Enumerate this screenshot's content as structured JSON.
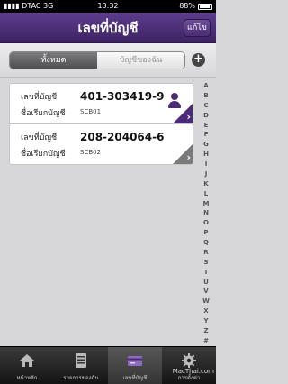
{
  "status_bar": {
    "carrier": "DTAC",
    "network": "3G",
    "time": "13:32",
    "battery": "88%"
  },
  "nav": {
    "title": "เลขที่บัญชี",
    "edit_label": "แก้ไข"
  },
  "segment": {
    "options": [
      "ทั้งหมด",
      "บัญชีของฉัน"
    ],
    "selected": "ทั้งหมด"
  },
  "add_icon": "+",
  "accounts": [
    {
      "label_number": "เลขที่บัญชี",
      "label_name": "ชื่อเรียกบัญชี",
      "number": "401-303419-9",
      "code": "SCB01",
      "owner_icon": "person-icon",
      "accent": "#4b2a78"
    },
    {
      "label_number": "เลขที่บัญชี",
      "label_name": "ชื่อเรียกบัญชี",
      "number": "208-204064-6",
      "code": "SCB02",
      "accent": "#7a7a7a"
    }
  ],
  "index_letters": [
    "A",
    "B",
    "C",
    "D",
    "E",
    "F",
    "G",
    "H",
    "I",
    "J",
    "K",
    "L",
    "M",
    "N",
    "O",
    "P",
    "Q",
    "R",
    "S",
    "T",
    "U",
    "V",
    "W",
    "X",
    "Y",
    "Z",
    "#"
  ],
  "tabs": [
    {
      "label": "หน้าหลัก",
      "icon": "home-icon"
    },
    {
      "label": "รายการของฉัน",
      "icon": "list-icon"
    },
    {
      "label": "เลขที่บัญชี",
      "icon": "card-icon",
      "selected": true
    },
    {
      "label": "การตั้งค่า",
      "icon": "gear-icon"
    }
  ],
  "watermark": "MacThai.com",
  "colors": {
    "brand": "#4b2a78",
    "nav_top": "#5e3d8d",
    "nav_bottom": "#3d2363"
  }
}
